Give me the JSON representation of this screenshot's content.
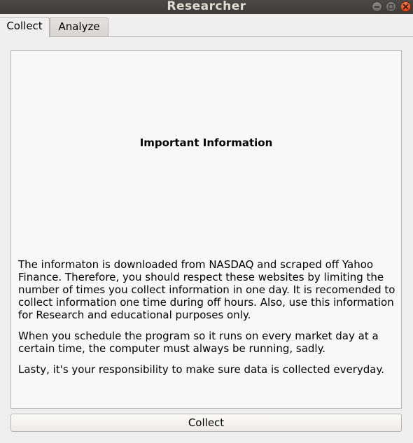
{
  "window": {
    "title": "Researcher",
    "controls": {
      "minimize": "minimize-icon",
      "maximize": "maximize-icon",
      "close": "close-icon"
    },
    "close_color": "#df4a16"
  },
  "tabs": [
    {
      "label": "Collect",
      "active": true
    },
    {
      "label": "Analyze",
      "active": false
    }
  ],
  "collect": {
    "heading": "Important Information",
    "paragraphs": [
      "The informaton is downloaded from NASDAQ and scraped off Yahoo Finance. Therefore, you should respect these websites by limiting the number of times you collect information in one day. It is recomended to collect information one time during off hours. Also, use this information for Research and educational purposes only.",
      "When you schedule the program so it runs on every market day at a certain time, the computer must always be running, sadly.",
      "Lasty, it's your responsibility to make sure data is collected everyday."
    ],
    "button_label": "Collect"
  }
}
